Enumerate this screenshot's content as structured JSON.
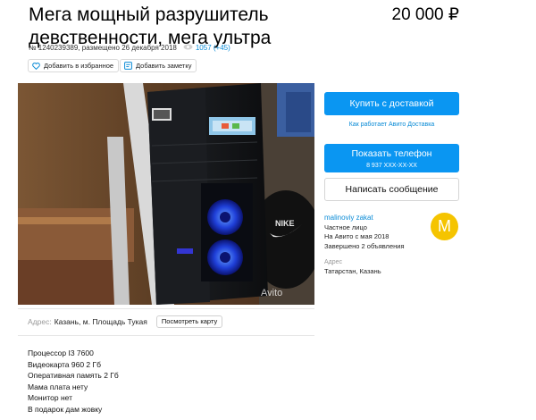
{
  "listing": {
    "title": "Мега мощный разрушитель девственности, мега ультра",
    "price": "20 000 ₽",
    "meta": "№ 1240239389, размещено 26 декабря 2018",
    "views": "1057 (+45)"
  },
  "actions": {
    "favorite_label": "Добавить в избранное",
    "note_label": "Добавить заметку"
  },
  "photo": {
    "watermark": "Avito"
  },
  "sidebar": {
    "buy_delivery": "Купить с доставкой",
    "delivery_link": "Как работает Авито Доставка",
    "show_phone": "Показать телефон",
    "phone_masked": "8 937 XXX-XX-XX",
    "write_message": "Написать сообщение"
  },
  "seller": {
    "name": "malinoviy zakat",
    "type": "Частное лицо",
    "since": "На Авито с мая 2018",
    "completed": "Завершено 2 объявления",
    "avatar_letter": "M",
    "address_label": "Адрес",
    "address_value": "Татарстан, Казань"
  },
  "address": {
    "label": "Адрес:",
    "value": "Казань, м. Площадь Тукая",
    "map_button": "Посмотреть карту"
  },
  "description": {
    "lines": [
      "Процессор I3 7600",
      "Видеокарта 960 2 Гб",
      "Оперативная память 2 Гб",
      "Мама плата нету",
      "Монитор нет",
      "В подарок дам жовку"
    ]
  },
  "colors": {
    "accent_blue": "#0a96f2",
    "link_blue": "#0a8bd6",
    "avatar_yellow": "#f5c400"
  }
}
